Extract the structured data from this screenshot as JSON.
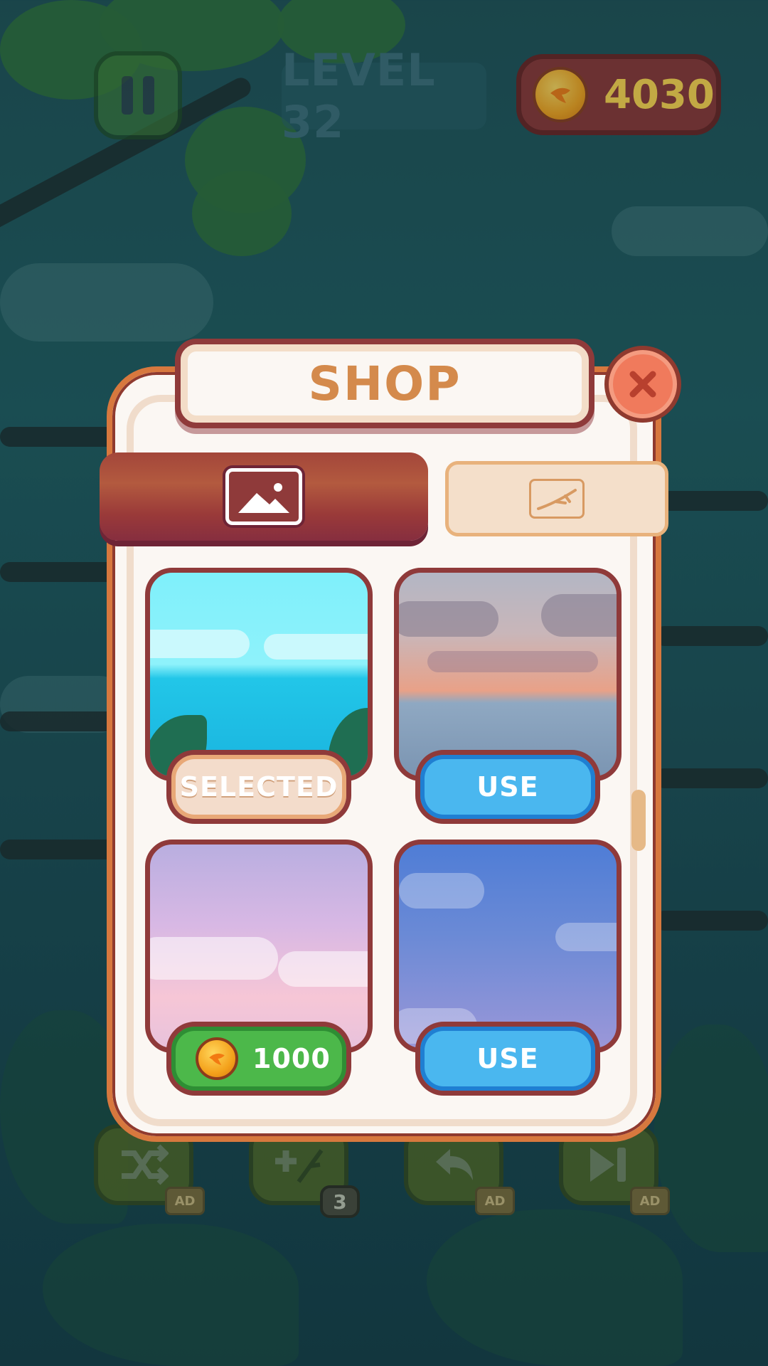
{
  "hud": {
    "level_label": "LEVEL 32",
    "coins": "4030"
  },
  "shop": {
    "title": "SHOP",
    "tabs": [
      {
        "name": "backgrounds",
        "icon": "image-icon",
        "active": true
      },
      {
        "name": "branches",
        "icon": "branch-icon",
        "active": false
      }
    ],
    "items": [
      {
        "name": "ocean-day",
        "button": "SELECTED",
        "state": "selected"
      },
      {
        "name": "sunset-sea",
        "button": "USE",
        "state": "owned"
      },
      {
        "name": "pink-sky",
        "button": "1000",
        "state": "locked"
      },
      {
        "name": "blue-night",
        "button": "USE",
        "state": "owned"
      }
    ]
  },
  "toolbar": {
    "tools": [
      {
        "name": "shuffle",
        "icon": "shuffle-icon",
        "badge": "AD"
      },
      {
        "name": "add-branch",
        "icon": "add-branch-icon",
        "badge": "3"
      },
      {
        "name": "undo",
        "icon": "undo-icon",
        "badge": "AD"
      },
      {
        "name": "skip",
        "icon": "skip-icon",
        "badge": "AD"
      }
    ]
  },
  "colors": {
    "panel_border": "#d7783e",
    "dark_outline": "#8f3a3a",
    "use_blue": "#4ab7ef",
    "buy_green": "#4cb84a",
    "coin_text": "#ffd44d"
  }
}
